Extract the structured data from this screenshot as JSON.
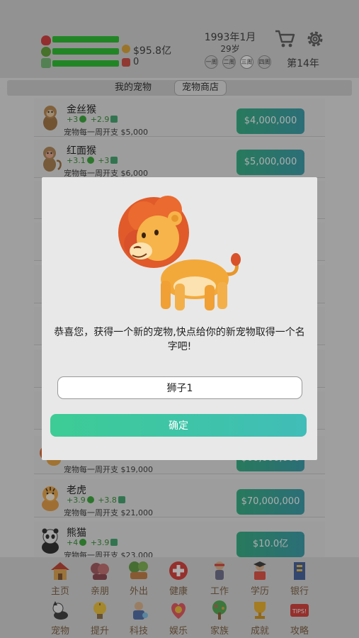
{
  "header": {
    "money": "$95.8亿",
    "debt": "0",
    "date": "1993年1月",
    "age": "29岁",
    "week_buttons": [
      "一周",
      "二周",
      "三周",
      "四周"
    ],
    "week_count": "第14年",
    "stats": [
      {
        "icon": "heart-icon",
        "level": 1.0
      },
      {
        "icon": "happy-face-icon",
        "level": 1.0
      },
      {
        "icon": "book-icon",
        "level": 1.0
      }
    ]
  },
  "tabs": {
    "my_pets": "我的宠物",
    "pet_shop": "宠物商店"
  },
  "pets": [
    {
      "name": "金丝猴",
      "s1": "+3",
      "s2": "+2.9",
      "cost": "宠物每一周开支  $5,000",
      "price": "$4,000,000"
    },
    {
      "name": "红面猴",
      "s1": "+3.1",
      "s2": "+3",
      "cost": "宠物每一周开支  $6,000",
      "price": "$5,000,000"
    },
    {
      "name": "",
      "s1": "",
      "s2": "",
      "cost": "宠物每一周开支  $19,000",
      "price": "$60,000,000"
    },
    {
      "name": "老虎",
      "s1": "+3.9",
      "s2": "+3.8",
      "cost": "宠物每一周开支  $21,000",
      "price": "$70,000,000"
    },
    {
      "name": "熊猫",
      "s1": "+4",
      "s2": "+3.9",
      "cost": "宠物每一周开支  $23,000",
      "price": "$10.0亿"
    }
  ],
  "nav": {
    "row1": [
      "主页",
      "亲朋",
      "外出",
      "健康",
      "工作",
      "学历",
      "银行"
    ],
    "row2": [
      "宠物",
      "提升",
      "科技",
      "娱乐",
      "家族",
      "成就",
      "攻略"
    ]
  },
  "dialog": {
    "message": "恭喜您，获得一个新的宠物,快点给你的新宠物取得一个名字吧!",
    "input_value": "狮子1",
    "confirm_label": "确定"
  }
}
